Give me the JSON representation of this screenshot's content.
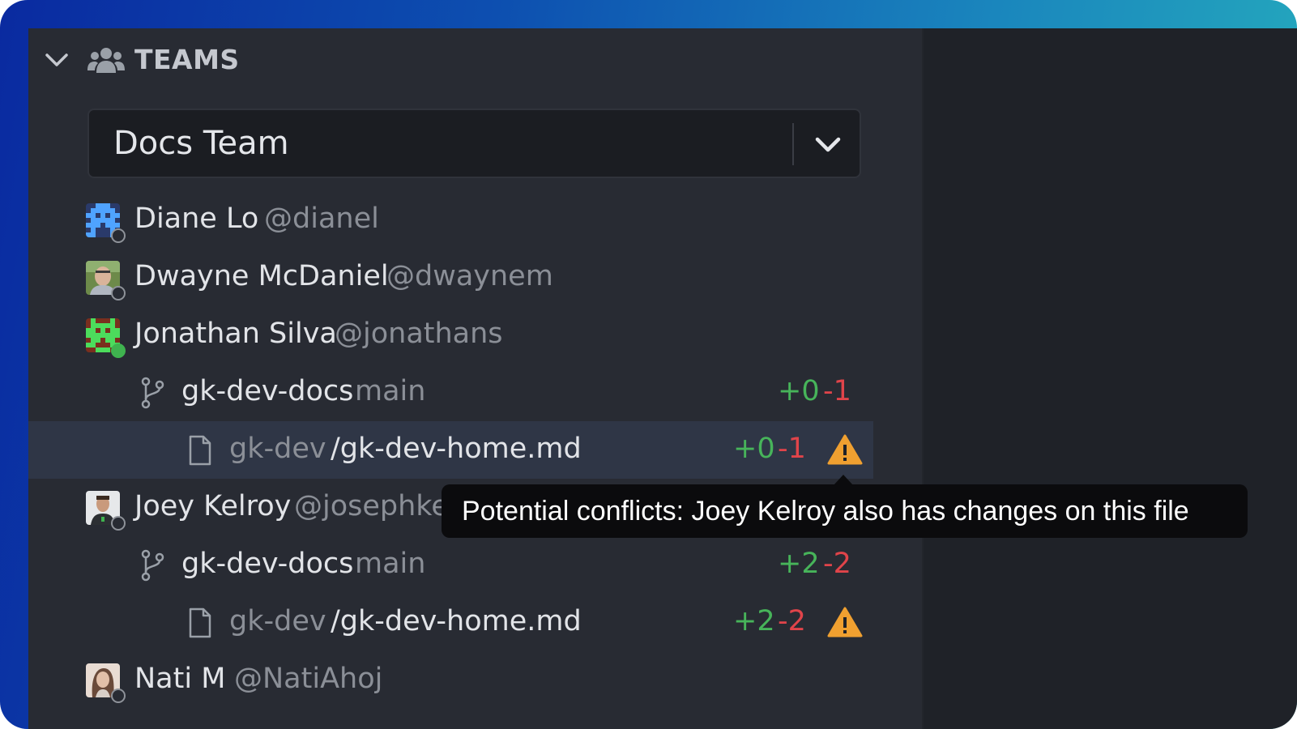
{
  "section": {
    "title": "TEAMS",
    "chevron_icon": "chevron-down-icon",
    "icon": "people-icon"
  },
  "team_select": {
    "value": "Docs Team",
    "icon": "chevron-down-icon"
  },
  "members": [
    {
      "name": "Diane Lo",
      "handle": "@dianel",
      "status": "offline"
    },
    {
      "name": "Dwayne McDaniel",
      "handle": "@dwaynem",
      "status": "offline"
    },
    {
      "name": "Jonathan Silva",
      "handle": "@jonathans",
      "status": "online",
      "repo": {
        "name": "gk-dev-docs",
        "branch": "main",
        "added": "+0",
        "removed": "-1"
      },
      "file": {
        "repo": "gk-dev",
        "path": "/gk-dev-home.md",
        "added": "+0",
        "removed": "-1",
        "warning": true
      }
    },
    {
      "name": "Joey Kelroy",
      "handle": "@josephkelroy",
      "status": "offline",
      "repo": {
        "name": "gk-dev-docs",
        "branch": "main",
        "added": "+2",
        "removed": "-2"
      },
      "file": {
        "repo": "gk-dev",
        "path": "/gk-dev-home.md",
        "added": "+2",
        "removed": "-2",
        "warning": true
      }
    },
    {
      "name": "Nati M",
      "handle": "@NatiAhoj",
      "status": "offline"
    }
  ],
  "tooltip": {
    "text": "Potential conflicts: Joey Kelroy also has changes on this file"
  },
  "colors": {
    "added": "#47b45a",
    "removed": "#e0444a",
    "warning": "#f0a030",
    "online": "#3fb34f",
    "selected_row": "#2f3646"
  }
}
